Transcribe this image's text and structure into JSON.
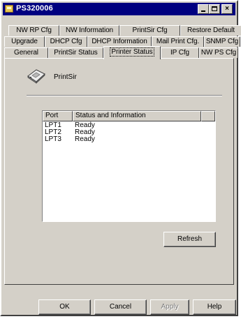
{
  "window": {
    "title": "PS320006"
  },
  "title_buttons": {
    "minimize": "minimize",
    "maximize": "maximize",
    "close": "×"
  },
  "tabs": {
    "row1": [
      "NW RP Cfg",
      "NW Information",
      "PrintSir Cfg",
      "Restore Default"
    ],
    "row2": [
      "Upgrade",
      "DHCP Cfg",
      "DHCP Information",
      "Mail Print Cfg.",
      "SNMP Cfg"
    ],
    "row3": [
      "General",
      "PrintSir Status",
      "Printer Status",
      "IP Cfg",
      "NW PS Cfg"
    ],
    "active": "Printer Status"
  },
  "panel": {
    "device_label": "PrintSir",
    "list": {
      "columns": [
        "Port",
        "Status and Information",
        ""
      ],
      "rows": [
        {
          "port": "LPT1",
          "status": "Ready"
        },
        {
          "port": "LPT2",
          "status": "Ready"
        },
        {
          "port": "LPT3",
          "status": "Ready"
        }
      ]
    },
    "refresh_label": "Refresh"
  },
  "footer": {
    "ok": "OK",
    "cancel": "Cancel",
    "apply": "Apply",
    "help": "Help",
    "apply_disabled": true
  },
  "icons": {
    "app": "printer-server-icon",
    "device": "printer-device-icon"
  }
}
